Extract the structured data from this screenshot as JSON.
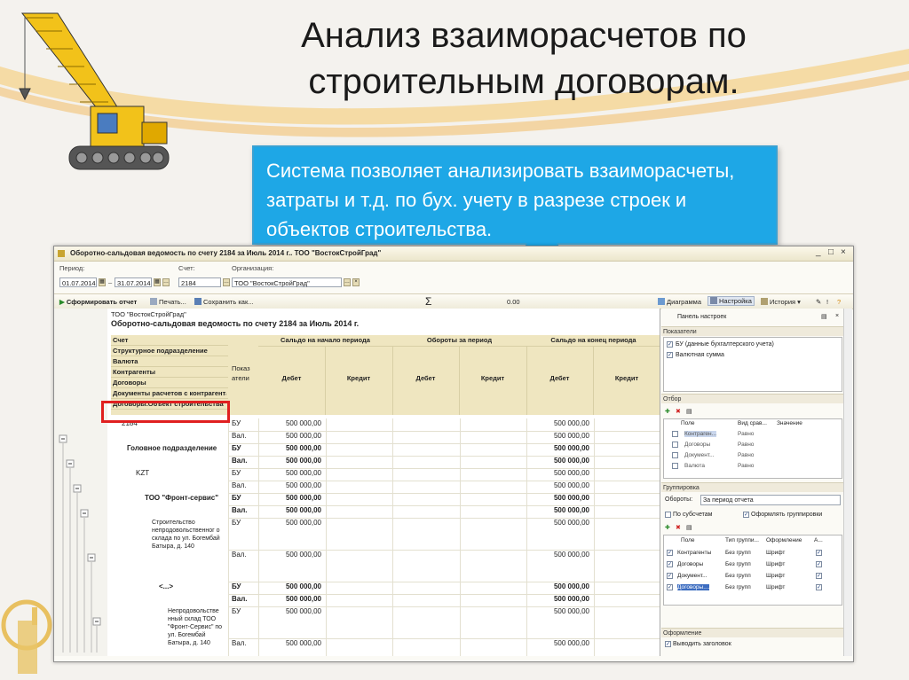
{
  "slide": {
    "title_line1": "Анализ взаиморасчетов по",
    "title_line2": "строительным договорам.",
    "callout_text": "Система позволяет анализировать взаиморасчеты, затраты и т.д. по бух. учету в разрезе строек и объектов строительства."
  },
  "window": {
    "title": "Оборотно-сальдовая ведомость по счету 2184 за Июль 2014 г.. ТОО \"ВостокСтройГрад\"",
    "period_label": "Период:",
    "period_from": "01.07.2014",
    "period_sep": "–",
    "period_to": "31.07.2014",
    "account_label": "Счет:",
    "account_value": "2184",
    "org_label": "Организация:",
    "org_value": "ТОО \"ВостокСтройГрад\"",
    "toolbar": {
      "generate": "Сформировать отчет",
      "print": "Печать...",
      "save": "Сохранить как...",
      "sigma": "Σ",
      "sum": "0.00",
      "diagram": "Диаграмма",
      "settings": "Настройка",
      "history": "История"
    }
  },
  "report": {
    "org": "ТОО \"ВостокСтройГрад\"",
    "title": "Оборотно-сальдовая ведомость по счету 2184 за Июль 2014 г.",
    "left_headers": [
      "Счет",
      "Структурное подразделение",
      "Валюта",
      "Контрагенты",
      "Договоры",
      "Документы расчетов с контрагентами",
      "Договоры.Объект строительства"
    ],
    "pokaz": "Показ атели",
    "groups": [
      "Сальдо на начало периода",
      "Обороты за период",
      "Сальдо на конец периода"
    ],
    "sub": [
      "Дебет",
      "Кредит",
      "Дебет",
      "Кредит",
      "Дебет",
      "Кредит"
    ],
    "rows": [
      {
        "label": "2184",
        "ind": "БУ",
        "d1": "500 000,00",
        "d3": "500 000,00",
        "bold": false
      },
      {
        "label": "",
        "ind": "Вал.",
        "d1": "500 000,00",
        "d3": "500 000,00",
        "bold": false
      },
      {
        "label": "Головное подразделение",
        "ind": "БУ",
        "d1": "500 000,00",
        "d3": "500 000,00",
        "bold": true
      },
      {
        "label": "",
        "ind": "Вал.",
        "d1": "500 000,00",
        "d3": "500 000,00",
        "bold": true
      },
      {
        "label": "KZT",
        "ind": "БУ",
        "d1": "500 000,00",
        "d3": "500 000,00",
        "bold": false
      },
      {
        "label": "",
        "ind": "Вал.",
        "d1": "500 000,00",
        "d3": "500 000,00",
        "bold": false
      },
      {
        "label": "ТОО \"Фронт-сервис\"",
        "ind": "БУ",
        "d1": "500 000,00",
        "d3": "500 000,00",
        "bold": true
      },
      {
        "label": "",
        "ind": "Вал.",
        "d1": "500 000,00",
        "d3": "500 000,00",
        "bold": true
      },
      {
        "label": "Строительство непродовольственног о склада по ул. Богембай Батыра, д. 140",
        "ind": "БУ",
        "d1": "500 000,00",
        "d3": "500 000,00",
        "bold": false
      },
      {
        "label": "",
        "ind": "Вал.",
        "d1": "500 000,00",
        "d3": "500 000,00",
        "bold": false
      },
      {
        "label": "<...>",
        "ind": "БУ",
        "d1": "500 000,00",
        "d3": "500 000,00",
        "bold": true
      },
      {
        "label": "",
        "ind": "Вал.",
        "d1": "500 000,00",
        "d3": "500 000,00",
        "bold": true
      },
      {
        "label": "Непродовольстве нный склад ТОО \"Фронт-Сервис\" по ул. Богембай Батыра, д. 140",
        "ind": "БУ",
        "d1": "500 000,00",
        "d3": "500 000,00",
        "bold": false
      },
      {
        "label": "",
        "ind": "Вал.",
        "d1": "500 000,00",
        "d3": "500 000,00",
        "bold": false
      }
    ]
  },
  "panel": {
    "title": "Панель настроек",
    "indicators_h": "Показатели",
    "indicators": [
      "БУ (данные бухгалтерского учета)",
      "Валютная сумма"
    ],
    "filter_h": "Отбор",
    "filter_cols": [
      "Поле",
      "Вид срав...",
      "Значение"
    ],
    "filter_rows": [
      [
        "Контраген...",
        "Равно"
      ],
      [
        "Договоры",
        "Равно"
      ],
      [
        "Документ...",
        "Равно"
      ],
      [
        "Валюта",
        "Равно"
      ]
    ],
    "group_h": "Группировка",
    "turnover_label": "Обороты:",
    "turnover_value": "За период отчета",
    "by_subaccounts": "По субсчетам",
    "format_groups": "Оформлять группировки",
    "group_cols": [
      "Поле",
      "Тип группи...",
      "Оформление",
      "А..."
    ],
    "group_rows": [
      [
        "Контрагенты",
        "Без групп",
        "Шрифт"
      ],
      [
        "Договоры",
        "Без групп",
        "Шрифт"
      ],
      [
        "Документ...",
        "Без групп",
        "Шрифт"
      ],
      [
        "Договоры....",
        "Без групп",
        "Шрифт"
      ]
    ],
    "design_h": "Оформление",
    "show_title": "Выводить заголовок"
  }
}
